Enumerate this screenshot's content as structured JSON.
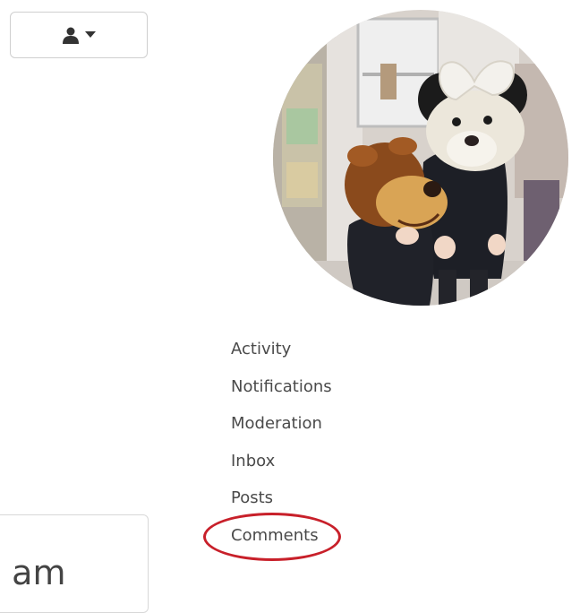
{
  "header": {
    "user_menu_button": {
      "icon": "user-icon",
      "caret_icon": "caret-down-icon"
    }
  },
  "profile": {
    "avatar_alt": "profile avatar"
  },
  "menu": {
    "items": [
      {
        "label": "Activity"
      },
      {
        "label": "Notifications"
      },
      {
        "label": "Moderation"
      },
      {
        "label": "Inbox"
      },
      {
        "label": "Posts"
      },
      {
        "label": "Comments"
      }
    ],
    "highlighted": "Comments",
    "highlight_color": "#c8202a"
  },
  "content_card": {
    "text": ". am"
  }
}
